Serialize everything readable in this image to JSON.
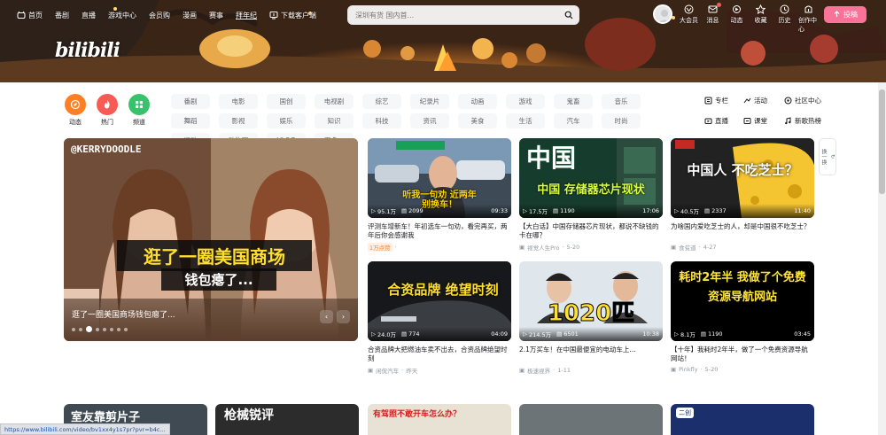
{
  "header": {
    "nav_left": [
      {
        "label": "首页",
        "icon": "bilibili-icon"
      },
      {
        "label": "番剧"
      },
      {
        "label": "直播"
      },
      {
        "label": "游戏中心"
      },
      {
        "label": "会员购"
      },
      {
        "label": "漫画"
      },
      {
        "label": "赛事"
      },
      {
        "label": "拜年纪"
      },
      {
        "label": "下载客户端",
        "icon": "download-icon"
      }
    ],
    "search_placeholder": "深圳有货 国内首...",
    "nav_right": [
      {
        "label": "大会员",
        "icon": "vip-icon"
      },
      {
        "label": "消息",
        "icon": "message-icon"
      },
      {
        "label": "动态",
        "icon": "dynamic-icon"
      },
      {
        "label": "收藏",
        "icon": "favorite-icon"
      },
      {
        "label": "历史",
        "icon": "history-icon"
      },
      {
        "label": "创作中心",
        "icon": "creator-icon"
      }
    ],
    "upload_label": "投稿",
    "logo_text": "bilibili"
  },
  "channels": {
    "circle": [
      {
        "label": "动态",
        "color": "#ff7f24"
      },
      {
        "label": "热门",
        "color": "#f85a54"
      },
      {
        "label": "频道",
        "color": "#3ac16c"
      }
    ],
    "tags": [
      "番剧",
      "电影",
      "国创",
      "电视剧",
      "综艺",
      "纪录片",
      "动画",
      "游戏",
      "鬼畜",
      "音乐",
      "舞蹈",
      "影视",
      "娱乐",
      "知识",
      "科技",
      "资讯",
      "美食",
      "生活",
      "汽车",
      "时尚",
      "运动",
      "动物圈",
      "VLOG",
      "更多"
    ],
    "links": [
      {
        "label": "专栏",
        "icon": "column-icon"
      },
      {
        "label": "活动",
        "icon": "activity-icon"
      },
      {
        "label": "社区中心",
        "icon": "community-icon"
      },
      {
        "label": "直播",
        "icon": "live-icon"
      },
      {
        "label": "课堂",
        "icon": "course-icon"
      },
      {
        "label": "新歌热榜",
        "icon": "music-icon"
      }
    ]
  },
  "carousel": {
    "title": "逛了一圈美国商场钱包瘪了...",
    "user_tag": "@KERRYDOODLE",
    "caption_line1": "逛了一圈美国商场",
    "caption_line2": "钱包瘪了...",
    "dots": 8,
    "active_dot": 3
  },
  "refresh_label": "换一换",
  "cards": [
    {
      "title": "评测车增新车！年初选车一句劝，看完再买，两年后你会感谢我",
      "views": "95.1万",
      "comments": "2099",
      "duration": "09:33",
      "author": "1万点赞",
      "date": "",
      "badge": true,
      "thumb_text": "听我一句劝 近两年别换车！"
    },
    {
      "title": "【大白话】中国存储器芯片现状，都说不缺钱的卡在哪？",
      "views": "17.5万",
      "comments": "1190",
      "duration": "17:06",
      "author": "视觉人生Pro",
      "date": "5-20",
      "badge": false,
      "thumb_text": "中国 存储器芯片现状"
    },
    {
      "title": "为啥国内爱吃芝士的人，却是中国很不吃芝士？",
      "views": "40.5万",
      "comments": "2337",
      "duration": "11:40",
      "author": "食贫道",
      "date": "4-27",
      "badge": false,
      "thumb_text": "中国人 不吃芝士？"
    },
    {
      "title": "合资品牌大把燃油车卖不出去，合资品牌绝望时刻",
      "views": "24.0万",
      "comments": "774",
      "duration": "04:09",
      "author": "闲侃汽车",
      "date": "昨天",
      "badge": false,
      "thumb_text": "合资品牌 绝望时刻"
    },
    {
      "title": "2.1万买车！在中国最便宜的电动车上…",
      "views": "214.5万",
      "comments": "6501",
      "duration": "10:38",
      "author": "极速视界",
      "date": "1-11",
      "badge": false,
      "thumb_text": "1020匹"
    },
    {
      "title": "【十年】我耗时2年半，做了一个免费资源导航网站！",
      "views": "8.1万",
      "comments": "1190",
      "duration": "03:45",
      "author": "Pinkfly",
      "date": "5-20",
      "badge": false,
      "thumb_text": "耗时2年半 我做了个免费 资源导航网站"
    }
  ],
  "bottom_row": [
    {
      "label": "室友靠剪片子"
    },
    {
      "label": "枪械锐评"
    },
    {
      "label": "有驾照不敢开车怎么办？"
    },
    {
      "label": ""
    },
    {
      "label": "二创"
    }
  ],
  "status_url": "https://www.bilibili.com/video/bv1xx4y1s7pr?pvr=b4c...",
  "colors": {
    "accent": "#fb7299",
    "blue": "#00aeec"
  }
}
